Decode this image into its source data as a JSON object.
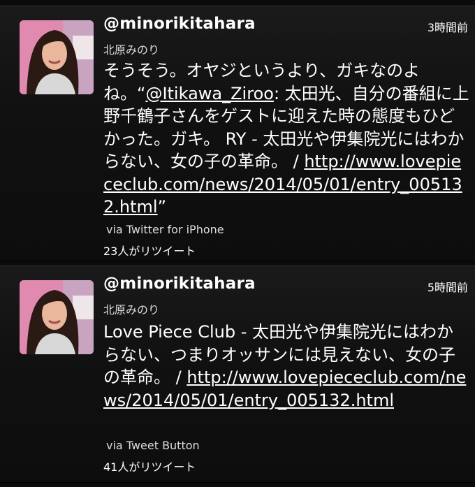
{
  "tweets": [
    {
      "handle": "@minorikitahara",
      "time": "3時間前",
      "name": "北原みのり",
      "text_a": "そうそう。オヤジというより、ガキなのよね。“",
      "mention": "@Itikawa_Ziroo",
      "text_b": ": 太田光、自分の番組に上野千鶴子さんをゲストに迎えた時の態度もひどかった。ガキ。 RY - 太田光や伊集院光にはわからない、女の子の革命。 / ",
      "link": "http://www.lovepiececlub.com/news/2014/05/01/entry_005132.html",
      "text_c": "”",
      "via": "via Twitter for iPhone",
      "retweets": "23人がリツイート"
    },
    {
      "handle": "@minorikitahara",
      "time": "5時間前",
      "name": "北原みのり",
      "text_a": "Love Piece Club - 太田光や伊集院光にはわからない、つまりオッサンには見えない、女の子の革命。 / ",
      "link": "http://www.lovepiececlub.com/news/2014/05/01/entry_005132.html",
      "via": "via Tweet Button",
      "retweets": "41人がリツイート"
    }
  ]
}
